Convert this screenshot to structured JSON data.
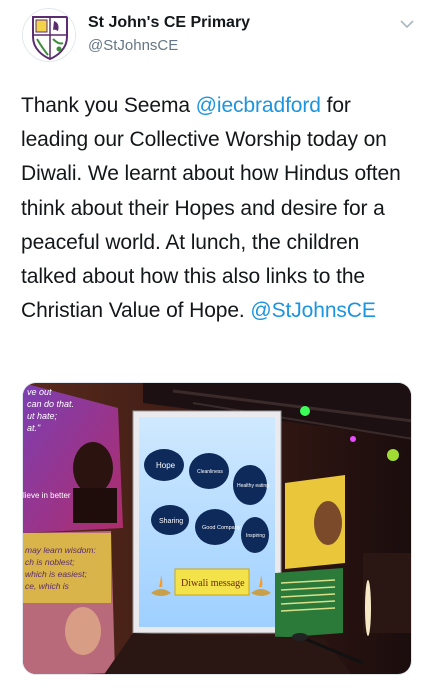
{
  "account": {
    "display_name": "St John's CE Primary",
    "handle": "@StJohnsCE"
  },
  "tweet": {
    "t1": "Thank you Seema ",
    "m1": "@iecbradford",
    "t2": " for leading our Collective Worship today on Diwali. We learnt about how Hindus often think about their Hopes and desire for a peaceful world. At lunch, the children talked about how this also links to the Christian Value of Hope. ",
    "m2": "@StJohnsCE"
  },
  "photo": {
    "slide_bubbles": [
      "Hope",
      "Cleanliness",
      "Healthy eating",
      "Sharing",
      "Good Company",
      "Inspiring"
    ],
    "slide_banner": "Diwali message",
    "left_poster_top": [
      "ve out",
      "can do that.",
      "ut hate;",
      "at.\""
    ],
    "left_poster_mid": "lieve in better",
    "left_poster_bottom": [
      "may learn wisdom:",
      "ch is noblest;",
      "which is easiest;",
      "ce, which is"
    ]
  },
  "icons": {
    "more": "chevron-down-icon",
    "avatar": "school-crest-logo"
  },
  "colors": {
    "mention": "#1b95e0",
    "secondary_text": "#657786"
  }
}
